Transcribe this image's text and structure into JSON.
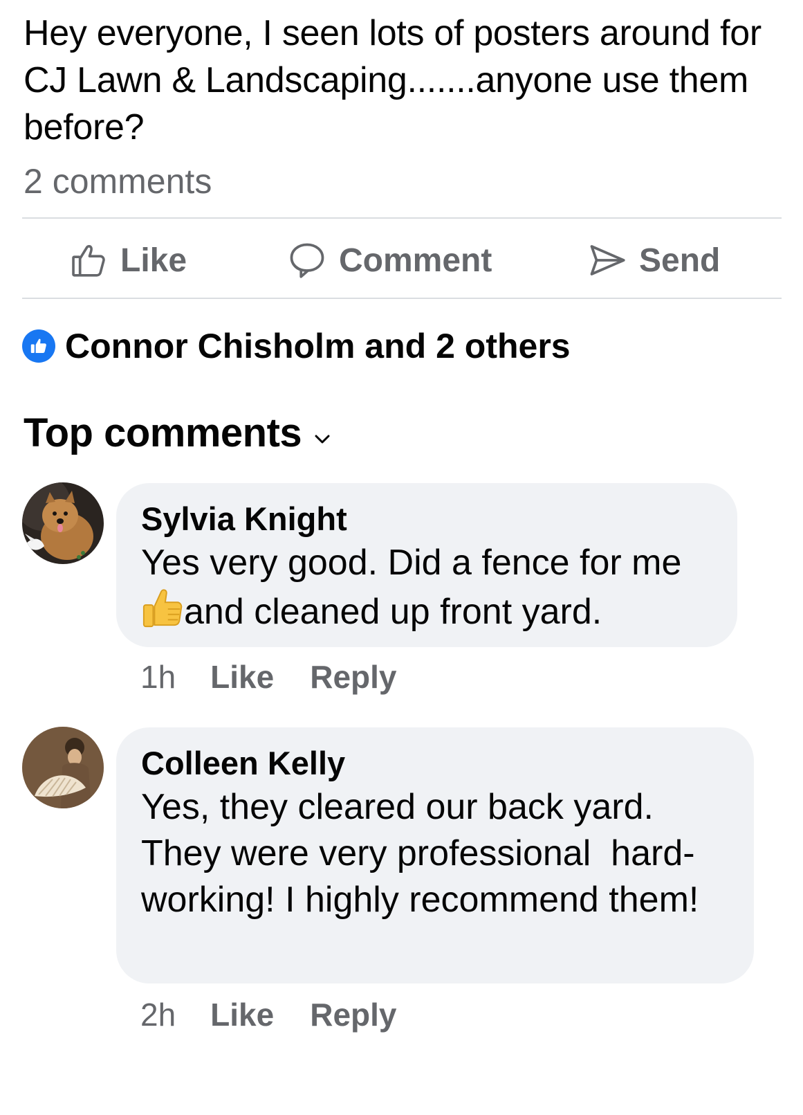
{
  "post": {
    "text": "Hey everyone, I seen lots of posters around for CJ Lawn & Landscaping.......anyone use them before?",
    "comment_count": "2 comments"
  },
  "actions": {
    "like": "Like",
    "comment": "Comment",
    "send": "Send"
  },
  "reactions": {
    "summary": "Connor Chisholm and 2 others",
    "icon": "like-icon",
    "color": "#1877f2"
  },
  "comments_section": {
    "title": "Top comments",
    "sort_icon": "chevron-down-icon"
  },
  "comments": [
    {
      "author": "Sylvia Knight",
      "text_before_emoji": "Yes very good. Did a fence for me ",
      "emoji": "thumbs-up-emoji",
      "text_after_emoji": "and cleaned up front yard.",
      "time": "1h",
      "like_label": "Like",
      "reply_label": "Reply"
    },
    {
      "author": "Colleen Kelly",
      "text": "Yes, they cleared our back yard. They were very professional  hard-working! I highly recommend them!",
      "time": "2h",
      "like_label": "Like",
      "reply_label": "Reply"
    }
  ],
  "colors": {
    "secondary_text": "#65676b",
    "bubble": "#f0f2f5",
    "divider": "#dadde1"
  }
}
